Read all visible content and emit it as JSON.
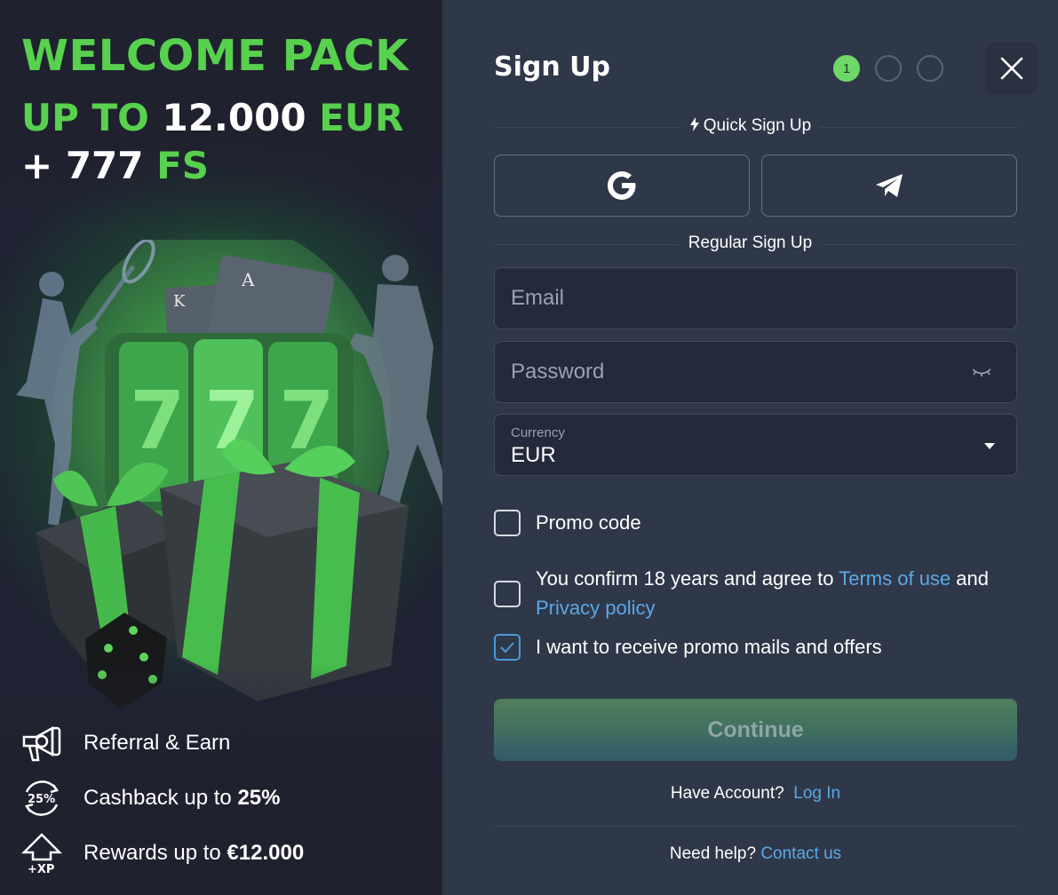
{
  "promo": {
    "headline_line1": "WELCOME PACK",
    "headline_line2_prefix": "UP TO ",
    "headline_line2_amount": "12.000",
    "headline_line2_suffix": " EUR",
    "headline_line3_prefix": "+ 777 ",
    "headline_line3_suffix": "FS",
    "perks": [
      {
        "icon": "megaphone-dollar-icon",
        "text": "Referral & Earn",
        "bold": ""
      },
      {
        "icon": "cashback-25-icon",
        "badge": "25%",
        "text": "Cashback up to ",
        "bold": "25%"
      },
      {
        "icon": "xp-arrow-icon",
        "badge": "+XP",
        "text": "Rewards up to ",
        "bold": "€12.000"
      }
    ],
    "slot_digits": "777"
  },
  "form": {
    "title": "Sign Up",
    "steps": [
      "1",
      "",
      ""
    ],
    "quick_label": "Quick Sign Up",
    "regular_label": "Regular Sign Up",
    "email_placeholder": "Email",
    "password_placeholder": "Password",
    "currency_label": "Currency",
    "currency_value": "EUR",
    "promo_label": "Promo code",
    "terms_prefix": "You confirm 18 years and agree to ",
    "terms_link": "Terms of use",
    "terms_and": " and",
    "privacy_link": "Privacy policy",
    "mails_label": "I want to receive promo mails and offers",
    "continue_label": "Continue",
    "have_account": "Have Account?",
    "login_link": "Log In",
    "need_help": "Need help?",
    "contact_link": "Contact us"
  },
  "colors": {
    "accent_green": "#58d14e",
    "link_blue": "#5aa9e6",
    "panel_bg": "#2f3849"
  }
}
